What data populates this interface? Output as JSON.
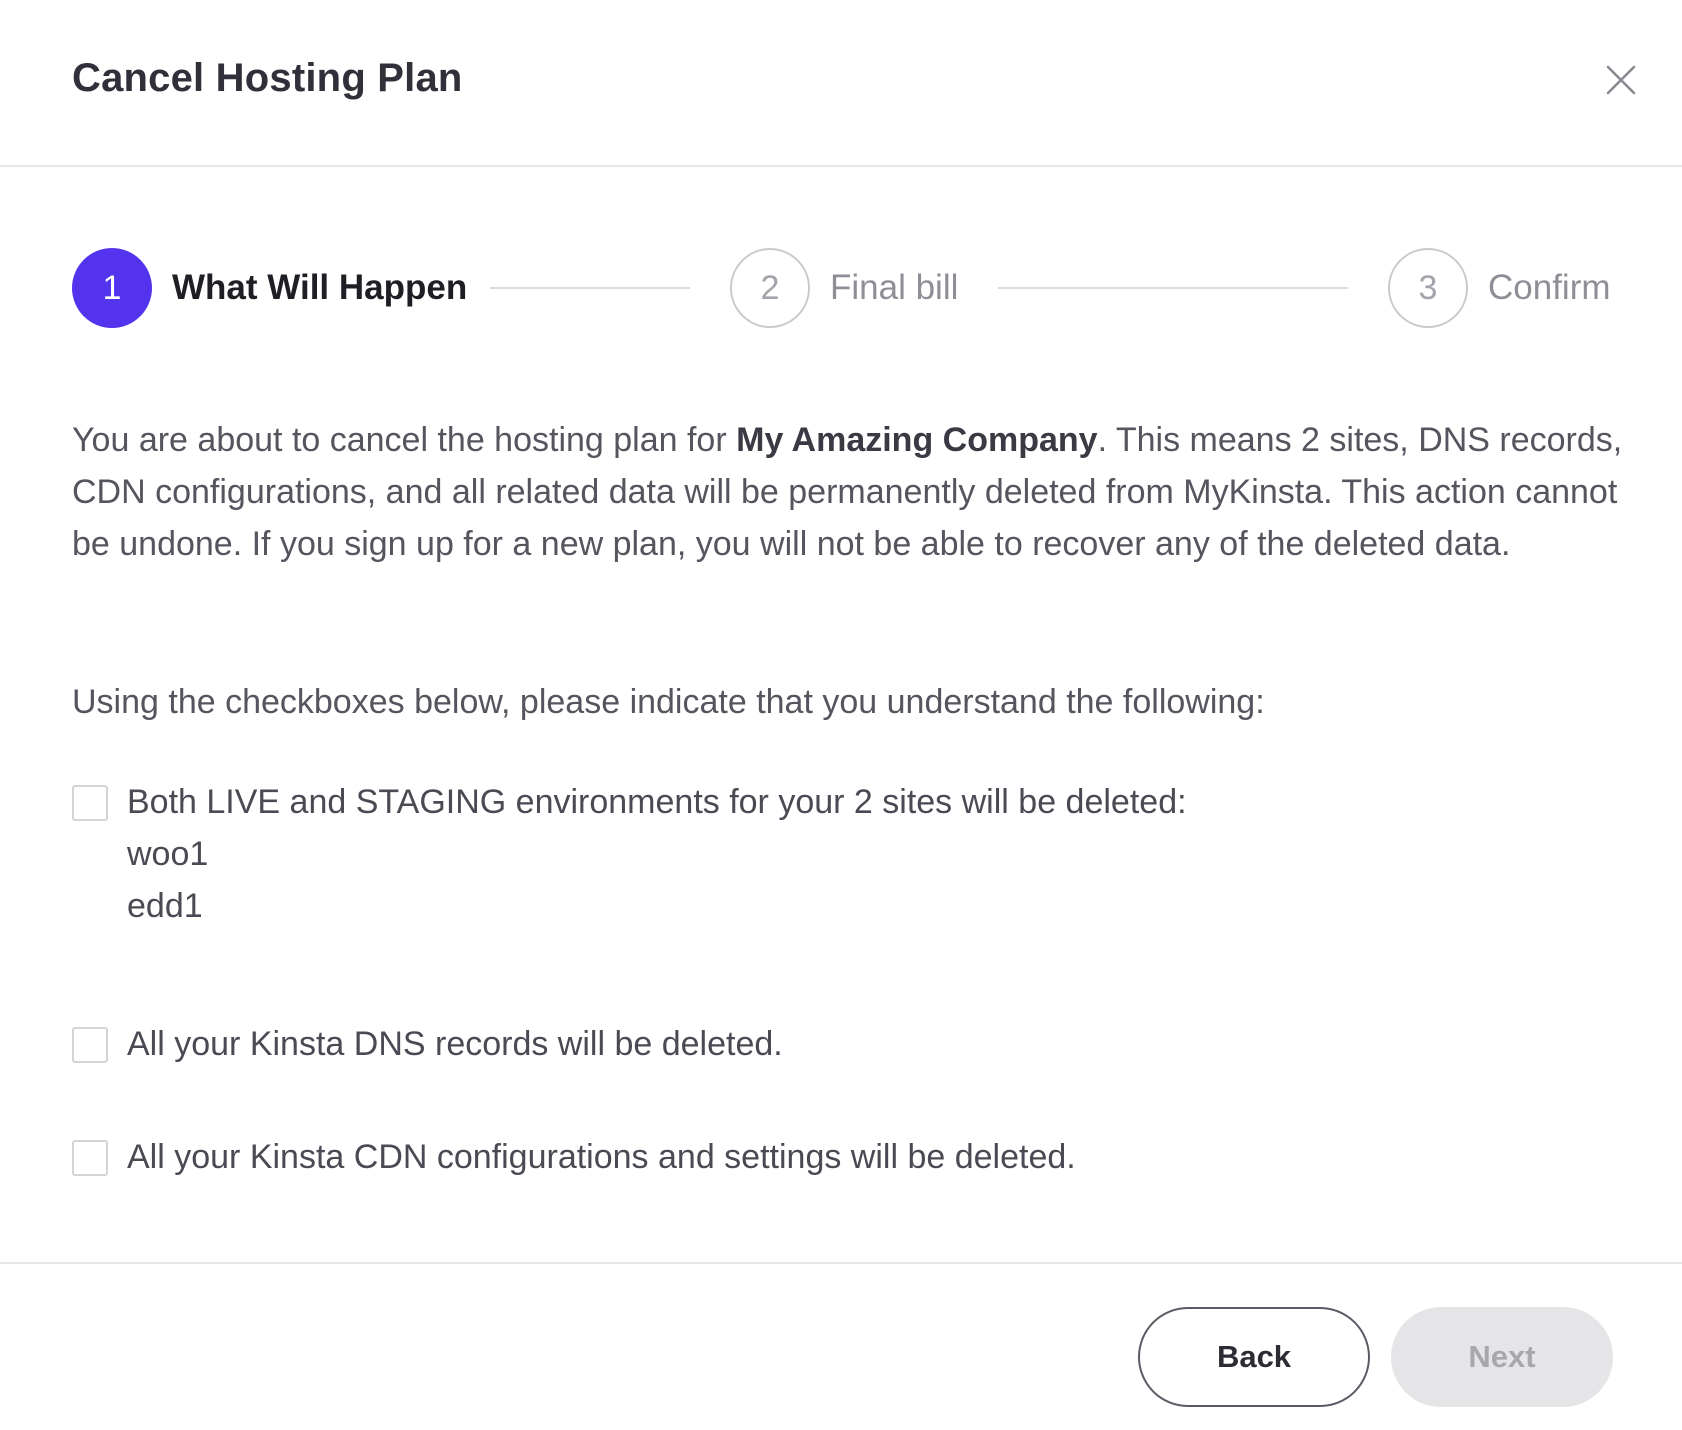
{
  "dialog": {
    "title": "Cancel Hosting Plan",
    "close_icon": "close-icon"
  },
  "stepper": {
    "steps": [
      {
        "number": "1",
        "label": "What Will Happen",
        "state": "active"
      },
      {
        "number": "2",
        "label": "Final bill",
        "state": "inactive"
      },
      {
        "number": "3",
        "label": "Confirm",
        "state": "inactive"
      }
    ],
    "active_color": "#5333ed"
  },
  "body": {
    "intro_before": "You are about to cancel the hosting plan for ",
    "company_name": "My Amazing Company",
    "intro_after": ". This means 2 sites, DNS records, CDN configurations, and all related data will be permanently deleted from MyKinsta. This action cannot be undone. If you sign up for a new plan, you will not be able to recover any of the deleted data.",
    "instruction": "Using the checkboxes below, please indicate that you understand the following:"
  },
  "checkboxes": [
    {
      "label": "Both LIVE and STAGING environments for your 2 sites will be deleted:",
      "checked": false,
      "sites": [
        "woo1",
        "edd1"
      ]
    },
    {
      "label": "All your Kinsta DNS records will be deleted.",
      "checked": false
    },
    {
      "label": "All your Kinsta CDN configurations and settings will be deleted.",
      "checked": false
    }
  ],
  "footer": {
    "back_label": "Back",
    "next_label": "Next",
    "next_disabled": true
  }
}
